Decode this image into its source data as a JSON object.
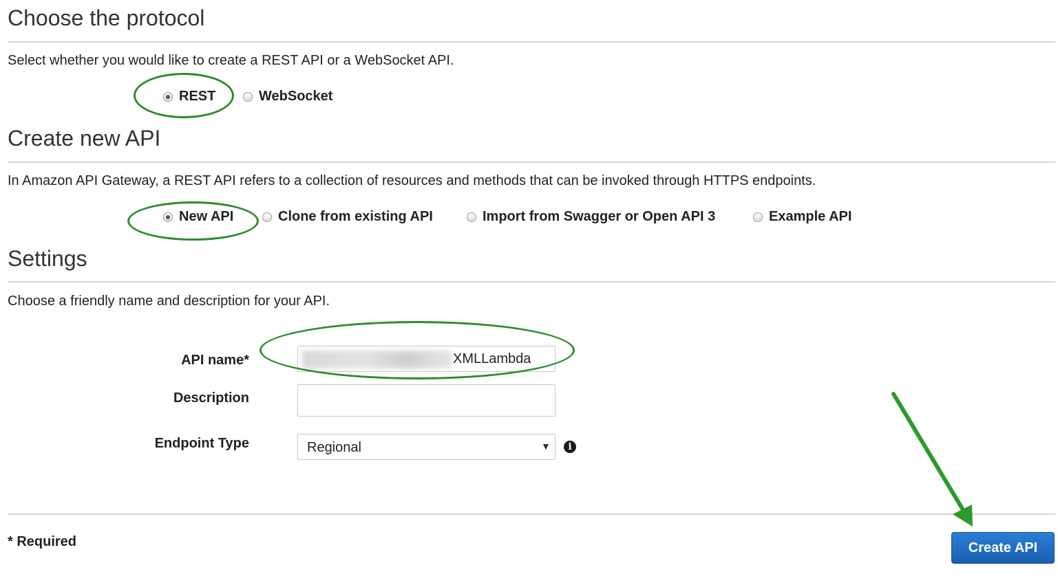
{
  "protocol": {
    "heading": "Choose the protocol",
    "description": "Select whether you would like to create a REST API or a WebSocket API.",
    "options": [
      {
        "label": "REST",
        "selected": true
      },
      {
        "label": "WebSocket",
        "selected": false
      }
    ]
  },
  "create": {
    "heading": "Create new API",
    "description": "In Amazon API Gateway, a REST API refers to a collection of resources and methods that can be invoked through HTTPS endpoints.",
    "options": [
      {
        "label": "New API",
        "selected": true
      },
      {
        "label": "Clone from existing API",
        "selected": false
      },
      {
        "label": "Import from Swagger or Open API 3",
        "selected": false
      },
      {
        "label": "Example API",
        "selected": false
      }
    ]
  },
  "settings": {
    "heading": "Settings",
    "description": "Choose a friendly name and description for your API.",
    "api_name_label": "API name*",
    "api_name_value": "XMLLambda",
    "description_label": "Description",
    "description_value": "",
    "endpoint_label": "Endpoint Type",
    "endpoint_value": "Regional",
    "info_icon": "info-icon"
  },
  "footer": {
    "required_note": "* Required",
    "create_button": "Create API"
  },
  "annotations": {
    "highlight_color": "#2e8b2e",
    "arrow_color": "#2d9a2d"
  },
  "colors": {
    "button_blue": "#1f6cc4"
  }
}
